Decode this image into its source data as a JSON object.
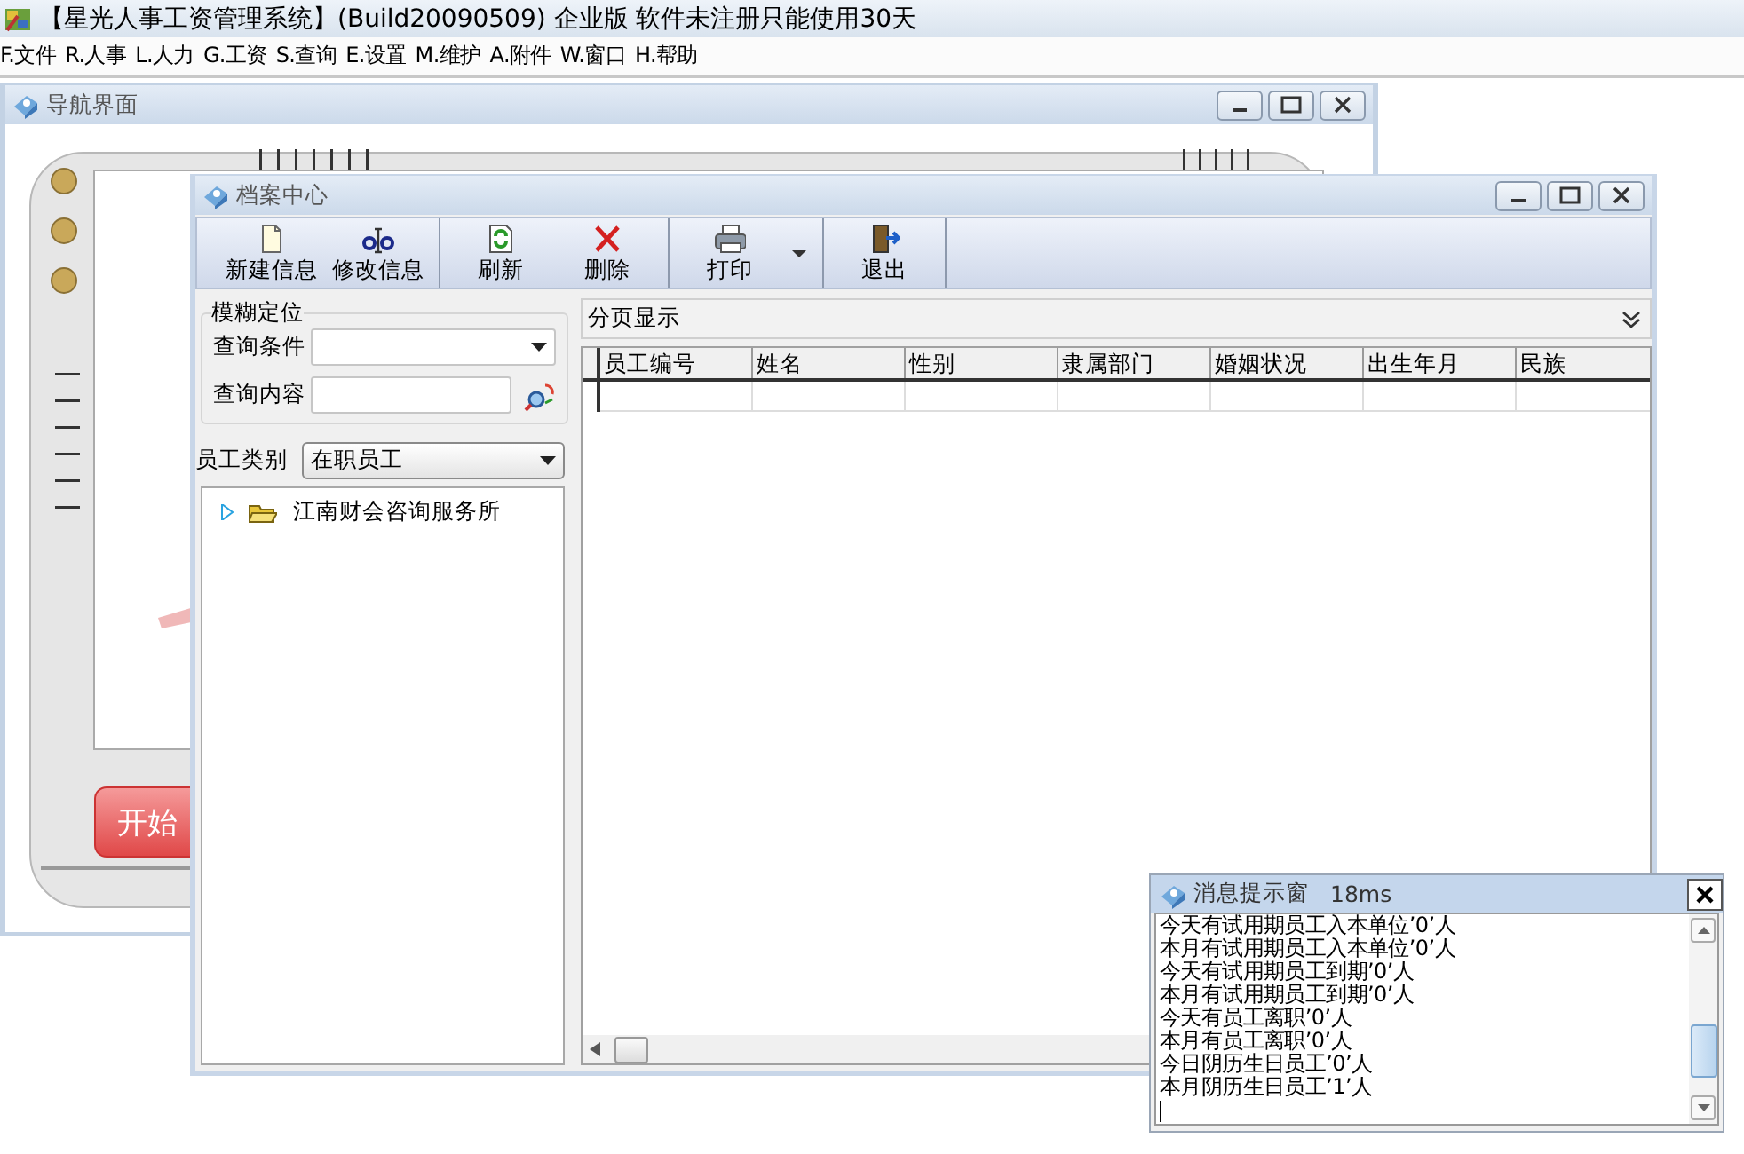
{
  "app": {
    "title": "【星光人事工资管理系统】(Build20090509) 企业版 软件未注册只能使用30天"
  },
  "menu": [
    "F.文件",
    "R.人事",
    "L.人力",
    "G.工资",
    "S.查询",
    "E.设置",
    "M.维护",
    "A.附件",
    "W.窗口",
    "H.帮助"
  ],
  "nav_window": {
    "title": "导航界面",
    "start_button": "开始"
  },
  "archive_window": {
    "title": "档案中心",
    "toolbar_groups": [
      {
        "items": [
          {
            "label": "新建信息",
            "kind": "new",
            "dropdown": false
          },
          {
            "label": "修改信息",
            "kind": "edit",
            "dropdown": false
          }
        ]
      },
      {
        "items": [
          {
            "label": "刷新",
            "kind": "refresh",
            "dropdown": false
          },
          {
            "label": "删除",
            "kind": "delete",
            "dropdown": false
          }
        ]
      },
      {
        "items": [
          {
            "label": "打印",
            "kind": "print",
            "dropdown": true
          }
        ]
      },
      {
        "items": [
          {
            "label": "退出",
            "kind": "exit",
            "dropdown": false
          }
        ]
      }
    ],
    "fuzzy_search": {
      "title": "模糊定位",
      "condition_label": "查询条件",
      "content_label": "查询内容"
    },
    "employee_type": {
      "label": "员工类别",
      "value": "在职员工"
    },
    "tree": [
      {
        "label": "江南财会咨询服务所",
        "expanded": false
      }
    ],
    "page_header": "分页显示",
    "table": {
      "columns": [
        "员工编号",
        "姓名",
        "性别",
        "隶属部门",
        "婚姻状况",
        "出生年月",
        "民族"
      ]
    }
  },
  "message_window": {
    "title": "消息提示窗",
    "timing": "18ms",
    "lines": [
      "今天有试用期员工入本单位’0’人",
      "本月有试用期员工入本单位’0’人",
      "今天有试用期员工到期’0’人",
      "本月有试用期员工到期’0’人",
      "今天有员工离职’0’人",
      "本月有员工离职’0’人",
      "今日阴历生日员工’0’人",
      "本月阴历生日员工’1’人"
    ]
  }
}
